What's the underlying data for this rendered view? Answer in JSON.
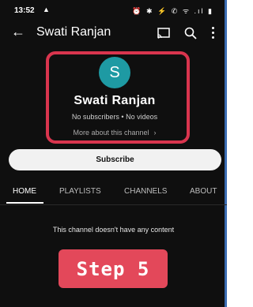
{
  "status_bar": {
    "time": "13:52",
    "notification_icon": "notification-icon",
    "system_icons": "⏰ ✱ ⚡ ✆ ᯤ .ıl ▮"
  },
  "app_bar": {
    "title": "Swati Ranjan",
    "icons": [
      "back-arrow-icon",
      "cast-icon",
      "search-icon",
      "more-vert-icon"
    ]
  },
  "channel": {
    "avatar_letter": "S",
    "avatar_color": "#1e9aa3",
    "name": "Swati Ranjan",
    "stats": "No subscribers • No videos",
    "more_about": "More about this channel"
  },
  "subscribe_label": "Subscribe",
  "tabs": [
    {
      "label": "HOME",
      "active": true
    },
    {
      "label": "PLAYLISTS"
    },
    {
      "label": "CHANNELS"
    },
    {
      "label": "ABOUT"
    }
  ],
  "empty_message": "This channel doesn't have any content",
  "overlay": {
    "step_label": "Step 5",
    "highlight_color": "#d9354e",
    "step_color": "#e3485a"
  }
}
